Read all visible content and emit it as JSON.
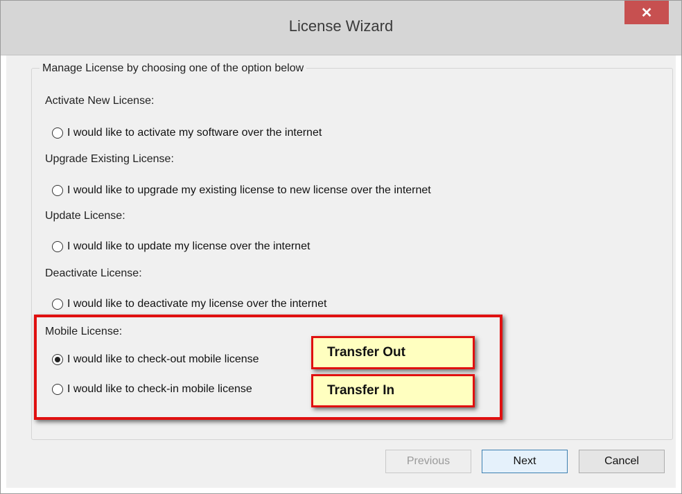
{
  "window": {
    "title": "License Wizard",
    "close_glyph": "✕"
  },
  "group": {
    "title": "Manage License by choosing one of the option below"
  },
  "sections": [
    {
      "label": "Activate New License:",
      "option": "I would like to activate my software over the internet",
      "checked": false
    },
    {
      "label": "Upgrade Existing License:",
      "option": "I would like to upgrade my existing license to new license over the internet",
      "checked": false
    },
    {
      "label": "Update License:",
      "option": "I would like to update my license over the internet",
      "checked": false
    },
    {
      "label": "Deactivate License:",
      "option": "I would like to deactivate my license over the internet",
      "checked": false
    }
  ],
  "mobile": {
    "label": "Mobile License:",
    "checkout_option": "I would like to check-out mobile license",
    "checkout_checked": true,
    "checkin_option": "I would like to check-in mobile license",
    "checkin_checked": false
  },
  "callouts": {
    "transfer_out": "Transfer Out",
    "transfer_in": "Transfer In"
  },
  "buttons": {
    "previous": "Previous",
    "previous_enabled": false,
    "next": "Next",
    "cancel": "Cancel"
  },
  "colors": {
    "highlight": "#e01010",
    "callout_bg": "#ffffc0",
    "close_bg": "#c75050"
  }
}
